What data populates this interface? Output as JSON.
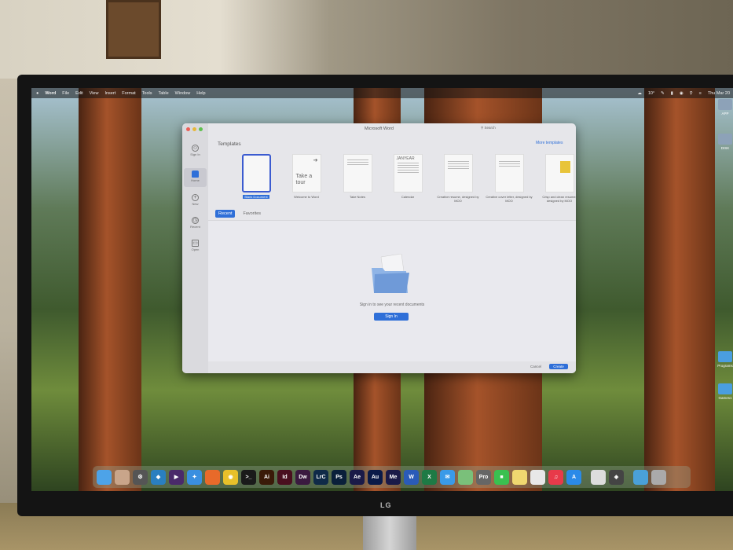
{
  "menubar": {
    "apple": "",
    "app": "Word",
    "items": [
      "File",
      "Edit",
      "View",
      "Insert",
      "Format",
      "Tools",
      "Table",
      "Window",
      "Help"
    ],
    "weather": "10°",
    "clock": "Thu Mar 20"
  },
  "window": {
    "title": "Microsoft Word",
    "search_placeholder": "Search",
    "templates_heading": "Templates",
    "more_templates": "More templates",
    "sidebar": [
      {
        "label": "Sign In",
        "icon": "person-icon",
        "glyph": "☺"
      },
      {
        "label": "Home",
        "icon": "home-icon",
        "glyph": ""
      },
      {
        "label": "New",
        "icon": "plus-icon",
        "glyph": "+"
      },
      {
        "label": "Recent",
        "icon": "clock-icon",
        "glyph": "◷"
      },
      {
        "label": "Open",
        "icon": "folder-icon",
        "glyph": "▭"
      }
    ],
    "templates": [
      {
        "label": "Blank Document",
        "thumb": ""
      },
      {
        "label": "Welcome to Word",
        "thumb": "Take a tour"
      },
      {
        "label": "Take Notes",
        "thumb": ""
      },
      {
        "label": "Calendar",
        "thumb": "JANYEAR"
      },
      {
        "label": "Creative resume, designed by MOO",
        "thumb": ""
      },
      {
        "label": "Creative cover letter, designed by MOO",
        "thumb": ""
      },
      {
        "label": "Crisp and clean resume, designed by MOO",
        "thumb": ""
      }
    ],
    "tabs": [
      "Recent",
      "Favorites"
    ],
    "empty_message": "Sign in to see your recent documents",
    "sign_in": "Sign In",
    "cancel": "Cancel",
    "create": "Create"
  },
  "desktop_icons": [
    "APP",
    "DISK",
    "Programs",
    "Games1"
  ],
  "dock": [
    {
      "n": "finder",
      "c": "#4da3e8",
      "t": ""
    },
    {
      "n": "launchpad",
      "c": "#c9a58a",
      "t": ""
    },
    {
      "n": "system-settings",
      "c": "#555",
      "t": "⚙"
    },
    {
      "n": "kodi",
      "c": "#2a7fbf",
      "t": "◆"
    },
    {
      "n": "media-player",
      "c": "#4a2a6a",
      "t": "▶"
    },
    {
      "n": "safari",
      "c": "#3a8fe0",
      "t": "✦"
    },
    {
      "n": "firefox",
      "c": "#e86a2a",
      "t": ""
    },
    {
      "n": "chrome",
      "c": "#e8c02a",
      "t": "◉"
    },
    {
      "n": "terminal",
      "c": "#1a1a1a",
      "t": ">_"
    },
    {
      "n": "illustrator",
      "c": "#3a1a08",
      "t": "Ai"
    },
    {
      "n": "indesign",
      "c": "#4a0f1f",
      "t": "Id"
    },
    {
      "n": "dreamweaver",
      "c": "#3a1a40",
      "t": "Dw"
    },
    {
      "n": "lightroom-classic",
      "c": "#0f2a48",
      "t": "LrC"
    },
    {
      "n": "photoshop",
      "c": "#0a1f3a",
      "t": "Ps"
    },
    {
      "n": "after-effects",
      "c": "#1a1a48",
      "t": "Ae"
    },
    {
      "n": "audition",
      "c": "#0a1a48",
      "t": "Au"
    },
    {
      "n": "media-encoder",
      "c": "#1a1a48",
      "t": "Me"
    },
    {
      "n": "word",
      "c": "#2a5bb8",
      "t": "W"
    },
    {
      "n": "excel",
      "c": "#1e7a45",
      "t": "X"
    },
    {
      "n": "mail",
      "c": "#3a9ae8",
      "t": "✉"
    },
    {
      "n": "maps",
      "c": "#7ac07a",
      "t": ""
    },
    {
      "n": "final-cut-pro",
      "c": "#666",
      "t": "Pro"
    },
    {
      "n": "facetime",
      "c": "#3ac050",
      "t": "■"
    },
    {
      "n": "notes",
      "c": "#f0d870",
      "t": ""
    },
    {
      "n": "freeform",
      "c": "#e8e8e8",
      "t": ""
    },
    {
      "n": "music",
      "c": "#e83a4a",
      "t": "♫"
    },
    {
      "n": "app-store",
      "c": "#2a8ae8",
      "t": "A"
    },
    {
      "n": "textedit",
      "c": "#ddd",
      "t": ""
    },
    {
      "n": "app-grid",
      "c": "#444",
      "t": "◈"
    },
    {
      "n": "downloads",
      "c": "#4aa0d8",
      "t": ""
    },
    {
      "n": "trash",
      "c": "#aaa",
      "t": ""
    }
  ]
}
